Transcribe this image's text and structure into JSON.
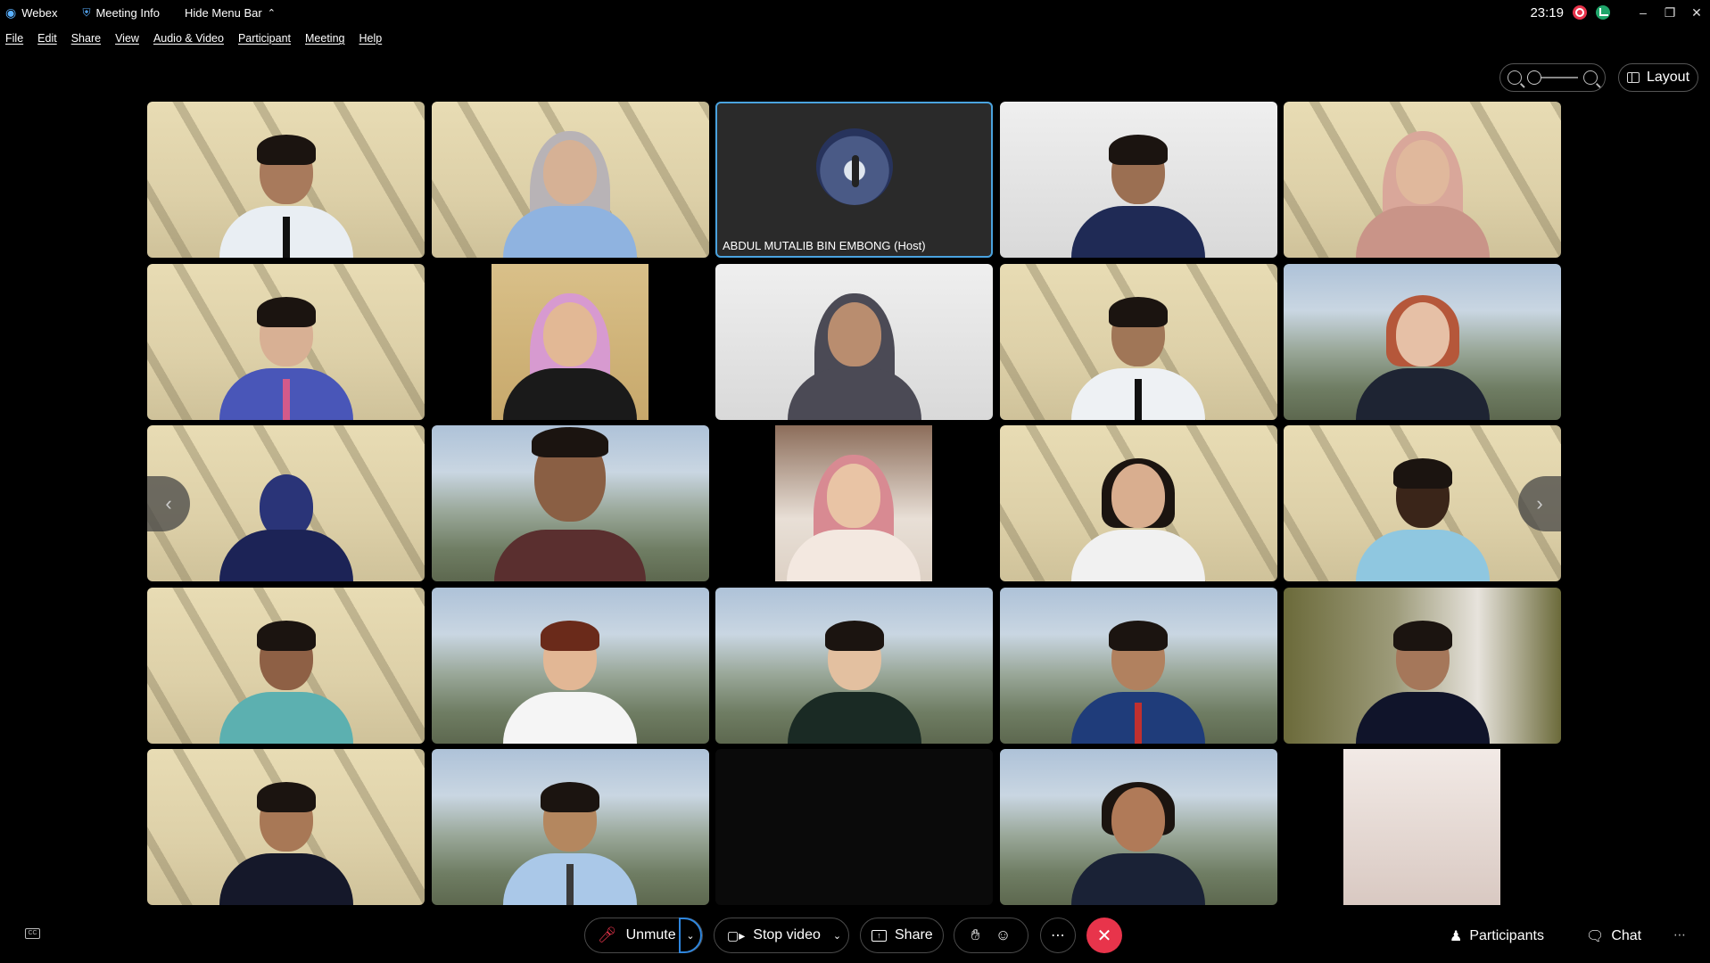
{
  "titlebar": {
    "app_name": "Webex",
    "meeting_info": "Meeting Info",
    "hide_menu_bar": "Hide Menu Bar",
    "clock": "23:19"
  },
  "menu": [
    "File",
    "Edit",
    "Share",
    "View",
    "Audio & Video",
    "Participant",
    "Meeting",
    "Help"
  ],
  "layout_label": "Layout",
  "host_label": "ABDUL MUTALIB BIN EMBONG (Host)",
  "toolbar": {
    "unmute": "Unmute",
    "stop_video": "Stop video",
    "share": "Share",
    "participants": "Participants",
    "chat": "Chat"
  },
  "colors": {
    "accent": "#2e86de",
    "end_call": "#e8344b",
    "active_speaker_outline": "#4aa3df"
  },
  "icons": [
    "webex-logo-icon",
    "shield-icon",
    "chevron-up-icon",
    "record-icon",
    "network-icon",
    "zoom-out-icon",
    "zoom-in-icon",
    "layout-grid-icon",
    "closed-caption-icon",
    "mic-muted-icon",
    "camera-icon",
    "share-icon",
    "raise-hand-icon",
    "emoji-icon",
    "more-icon",
    "end-call-icon",
    "participants-icon",
    "chat-icon"
  ]
}
